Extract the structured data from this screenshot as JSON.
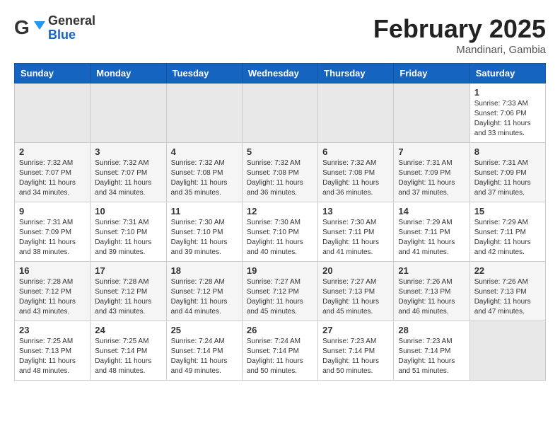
{
  "header": {
    "logo_line1": "General",
    "logo_line2": "Blue",
    "title": "February 2025",
    "subtitle": "Mandinari, Gambia"
  },
  "weekdays": [
    "Sunday",
    "Monday",
    "Tuesday",
    "Wednesday",
    "Thursday",
    "Friday",
    "Saturday"
  ],
  "weeks": [
    [
      {
        "day": "",
        "info": ""
      },
      {
        "day": "",
        "info": ""
      },
      {
        "day": "",
        "info": ""
      },
      {
        "day": "",
        "info": ""
      },
      {
        "day": "",
        "info": ""
      },
      {
        "day": "",
        "info": ""
      },
      {
        "day": "1",
        "info": "Sunrise: 7:33 AM\nSunset: 7:06 PM\nDaylight: 11 hours\nand 33 minutes."
      }
    ],
    [
      {
        "day": "2",
        "info": "Sunrise: 7:32 AM\nSunset: 7:07 PM\nDaylight: 11 hours\nand 34 minutes."
      },
      {
        "day": "3",
        "info": "Sunrise: 7:32 AM\nSunset: 7:07 PM\nDaylight: 11 hours\nand 34 minutes."
      },
      {
        "day": "4",
        "info": "Sunrise: 7:32 AM\nSunset: 7:08 PM\nDaylight: 11 hours\nand 35 minutes."
      },
      {
        "day": "5",
        "info": "Sunrise: 7:32 AM\nSunset: 7:08 PM\nDaylight: 11 hours\nand 36 minutes."
      },
      {
        "day": "6",
        "info": "Sunrise: 7:32 AM\nSunset: 7:08 PM\nDaylight: 11 hours\nand 36 minutes."
      },
      {
        "day": "7",
        "info": "Sunrise: 7:31 AM\nSunset: 7:09 PM\nDaylight: 11 hours\nand 37 minutes."
      },
      {
        "day": "8",
        "info": "Sunrise: 7:31 AM\nSunset: 7:09 PM\nDaylight: 11 hours\nand 37 minutes."
      }
    ],
    [
      {
        "day": "9",
        "info": "Sunrise: 7:31 AM\nSunset: 7:09 PM\nDaylight: 11 hours\nand 38 minutes."
      },
      {
        "day": "10",
        "info": "Sunrise: 7:31 AM\nSunset: 7:10 PM\nDaylight: 11 hours\nand 39 minutes."
      },
      {
        "day": "11",
        "info": "Sunrise: 7:30 AM\nSunset: 7:10 PM\nDaylight: 11 hours\nand 39 minutes."
      },
      {
        "day": "12",
        "info": "Sunrise: 7:30 AM\nSunset: 7:10 PM\nDaylight: 11 hours\nand 40 minutes."
      },
      {
        "day": "13",
        "info": "Sunrise: 7:30 AM\nSunset: 7:11 PM\nDaylight: 11 hours\nand 41 minutes."
      },
      {
        "day": "14",
        "info": "Sunrise: 7:29 AM\nSunset: 7:11 PM\nDaylight: 11 hours\nand 41 minutes."
      },
      {
        "day": "15",
        "info": "Sunrise: 7:29 AM\nSunset: 7:11 PM\nDaylight: 11 hours\nand 42 minutes."
      }
    ],
    [
      {
        "day": "16",
        "info": "Sunrise: 7:28 AM\nSunset: 7:12 PM\nDaylight: 11 hours\nand 43 minutes."
      },
      {
        "day": "17",
        "info": "Sunrise: 7:28 AM\nSunset: 7:12 PM\nDaylight: 11 hours\nand 43 minutes."
      },
      {
        "day": "18",
        "info": "Sunrise: 7:28 AM\nSunset: 7:12 PM\nDaylight: 11 hours\nand 44 minutes."
      },
      {
        "day": "19",
        "info": "Sunrise: 7:27 AM\nSunset: 7:12 PM\nDaylight: 11 hours\nand 45 minutes."
      },
      {
        "day": "20",
        "info": "Sunrise: 7:27 AM\nSunset: 7:13 PM\nDaylight: 11 hours\nand 45 minutes."
      },
      {
        "day": "21",
        "info": "Sunrise: 7:26 AM\nSunset: 7:13 PM\nDaylight: 11 hours\nand 46 minutes."
      },
      {
        "day": "22",
        "info": "Sunrise: 7:26 AM\nSunset: 7:13 PM\nDaylight: 11 hours\nand 47 minutes."
      }
    ],
    [
      {
        "day": "23",
        "info": "Sunrise: 7:25 AM\nSunset: 7:13 PM\nDaylight: 11 hours\nand 48 minutes."
      },
      {
        "day": "24",
        "info": "Sunrise: 7:25 AM\nSunset: 7:14 PM\nDaylight: 11 hours\nand 48 minutes."
      },
      {
        "day": "25",
        "info": "Sunrise: 7:24 AM\nSunset: 7:14 PM\nDaylight: 11 hours\nand 49 minutes."
      },
      {
        "day": "26",
        "info": "Sunrise: 7:24 AM\nSunset: 7:14 PM\nDaylight: 11 hours\nand 50 minutes."
      },
      {
        "day": "27",
        "info": "Sunrise: 7:23 AM\nSunset: 7:14 PM\nDaylight: 11 hours\nand 50 minutes."
      },
      {
        "day": "28",
        "info": "Sunrise: 7:23 AM\nSunset: 7:14 PM\nDaylight: 11 hours\nand 51 minutes."
      },
      {
        "day": "",
        "info": ""
      }
    ]
  ]
}
